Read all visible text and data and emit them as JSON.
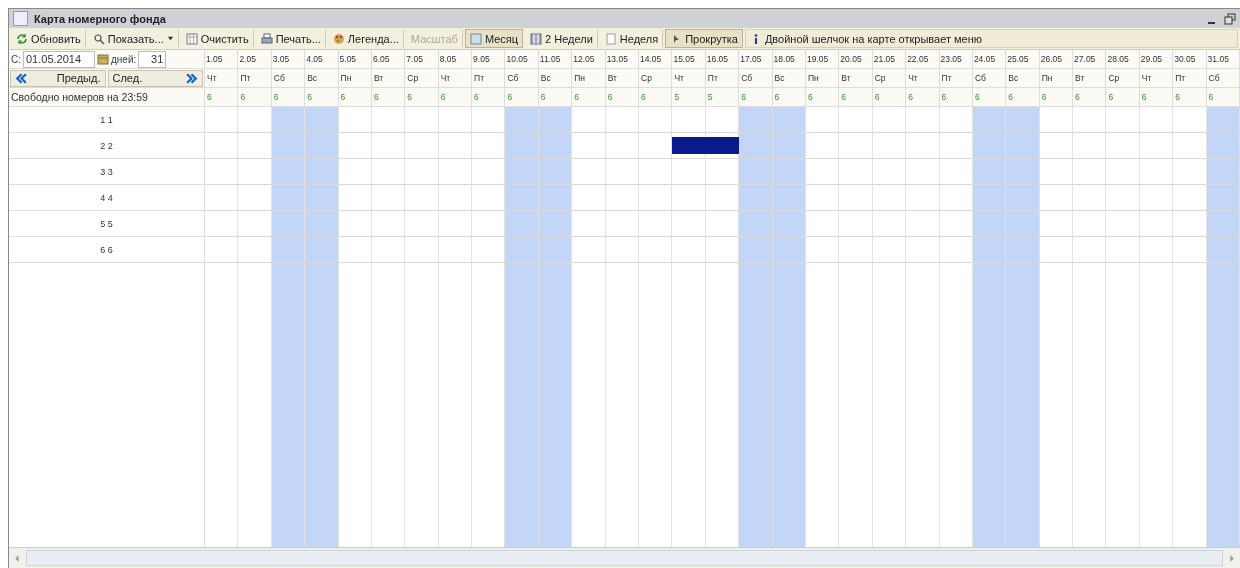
{
  "window": {
    "title": "Карта номерного фонда"
  },
  "toolbar": [
    {
      "kind": "refresh",
      "label": "Обновить",
      "pressed": false,
      "disabled": false
    },
    {
      "kind": "dropdown",
      "label": "Показать...",
      "pressed": false,
      "disabled": false
    },
    {
      "kind": "clear",
      "label": "Очистить",
      "pressed": false,
      "disabled": false
    },
    {
      "kind": "print",
      "label": "Печать...",
      "pressed": false,
      "disabled": false
    },
    {
      "kind": "legend",
      "label": "Легенда...",
      "pressed": false,
      "disabled": false
    },
    {
      "kind": "plain",
      "label": "Масштаб",
      "pressed": false,
      "disabled": true
    },
    {
      "kind": "month",
      "label": "Месяц",
      "pressed": true,
      "disabled": false
    },
    {
      "kind": "twoweeks",
      "label": "2 Недели",
      "pressed": false,
      "disabled": false
    },
    {
      "kind": "week",
      "label": "Неделя",
      "pressed": false,
      "disabled": false
    },
    {
      "kind": "scroll",
      "label": "Прокрутка",
      "pressed": true,
      "disabled": false
    },
    {
      "kind": "info",
      "label": "Двойной шелчок на карте открывает меню",
      "pressed": false,
      "disabled": false
    }
  ],
  "period": {
    "from_label": "С:",
    "from_value": "01.05.2014",
    "days_label": "дней:",
    "days_value": "31"
  },
  "nav": {
    "prev": "Предыд.",
    "next": "След."
  },
  "free_label": "Свободно номеров на 23:59",
  "days": [
    {
      "date": "1.05",
      "weekday": "Чт",
      "free": "6",
      "weekend": false
    },
    {
      "date": "2.05",
      "weekday": "Пт",
      "free": "6",
      "weekend": false
    },
    {
      "date": "3.05",
      "weekday": "Сб",
      "free": "6",
      "weekend": true
    },
    {
      "date": "4.05",
      "weekday": "Вс",
      "free": "6",
      "weekend": true
    },
    {
      "date": "5.05",
      "weekday": "Пн",
      "free": "6",
      "weekend": false
    },
    {
      "date": "6.05",
      "weekday": "Вт",
      "free": "6",
      "weekend": false
    },
    {
      "date": "7.05",
      "weekday": "Ср",
      "free": "6",
      "weekend": false
    },
    {
      "date": "8.05",
      "weekday": "Чт",
      "free": "6",
      "weekend": false
    },
    {
      "date": "9.05",
      "weekday": "Пт",
      "free": "6",
      "weekend": false
    },
    {
      "date": "10.05",
      "weekday": "Сб",
      "free": "6",
      "weekend": true
    },
    {
      "date": "11.05",
      "weekday": "Вс",
      "free": "6",
      "weekend": true
    },
    {
      "date": "12.05",
      "weekday": "Пн",
      "free": "6",
      "weekend": false
    },
    {
      "date": "13.05",
      "weekday": "Вт",
      "free": "6",
      "weekend": false
    },
    {
      "date": "14.05",
      "weekday": "Ср",
      "free": "6",
      "weekend": false
    },
    {
      "date": "15.05",
      "weekday": "Чт",
      "free": "5",
      "weekend": false
    },
    {
      "date": "16.05",
      "weekday": "Пт",
      "free": "5",
      "weekend": false
    },
    {
      "date": "17.05",
      "weekday": "Сб",
      "free": "6",
      "weekend": true
    },
    {
      "date": "18.05",
      "weekday": "Вс",
      "free": "6",
      "weekend": true
    },
    {
      "date": "19.05",
      "weekday": "Пн",
      "free": "6",
      "weekend": false
    },
    {
      "date": "20.05",
      "weekday": "Вт",
      "free": "6",
      "weekend": false
    },
    {
      "date": "21.05",
      "weekday": "Ср",
      "free": "6",
      "weekend": false
    },
    {
      "date": "22.05",
      "weekday": "Чт",
      "free": "6",
      "weekend": false
    },
    {
      "date": "23.05",
      "weekday": "Пт",
      "free": "6",
      "weekend": false
    },
    {
      "date": "24.05",
      "weekday": "Сб",
      "free": "6",
      "weekend": true
    },
    {
      "date": "25.05",
      "weekday": "Вс",
      "free": "6",
      "weekend": true
    },
    {
      "date": "26.05",
      "weekday": "Пн",
      "free": "6",
      "weekend": false
    },
    {
      "date": "27.05",
      "weekday": "Вт",
      "free": "6",
      "weekend": false
    },
    {
      "date": "28.05",
      "weekday": "Ср",
      "free": "6",
      "weekend": false
    },
    {
      "date": "29.05",
      "weekday": "Чт",
      "free": "6",
      "weekend": false
    },
    {
      "date": "30.05",
      "weekday": "Пт",
      "free": "6",
      "weekend": false
    },
    {
      "date": "31.05",
      "weekday": "Сб",
      "free": "6",
      "weekend": true
    }
  ],
  "rooms": [
    {
      "name": "1 1",
      "occupied": [
        false,
        false,
        false,
        false,
        false,
        false,
        false,
        false,
        false,
        false,
        false,
        false,
        false,
        false,
        false,
        false,
        false,
        false,
        false,
        false,
        false,
        false,
        false,
        false,
        false,
        false,
        false,
        false,
        false,
        false,
        false
      ]
    },
    {
      "name": "2 2",
      "occupied": [
        false,
        false,
        false,
        false,
        false,
        false,
        false,
        false,
        false,
        false,
        false,
        false,
        false,
        false,
        true,
        true,
        false,
        false,
        false,
        false,
        false,
        false,
        false,
        false,
        false,
        false,
        false,
        false,
        false,
        false,
        false
      ]
    },
    {
      "name": "3 3",
      "occupied": [
        false,
        false,
        false,
        false,
        false,
        false,
        false,
        false,
        false,
        false,
        false,
        false,
        false,
        false,
        false,
        false,
        false,
        false,
        false,
        false,
        false,
        false,
        false,
        false,
        false,
        false,
        false,
        false,
        false,
        false,
        false
      ]
    },
    {
      "name": "4 4",
      "occupied": [
        false,
        false,
        false,
        false,
        false,
        false,
        false,
        false,
        false,
        false,
        false,
        false,
        false,
        false,
        false,
        false,
        false,
        false,
        false,
        false,
        false,
        false,
        false,
        false,
        false,
        false,
        false,
        false,
        false,
        false,
        false
      ]
    },
    {
      "name": "5 5",
      "occupied": [
        false,
        false,
        false,
        false,
        false,
        false,
        false,
        false,
        false,
        false,
        false,
        false,
        false,
        false,
        false,
        false,
        false,
        false,
        false,
        false,
        false,
        false,
        false,
        false,
        false,
        false,
        false,
        false,
        false,
        false,
        false
      ]
    },
    {
      "name": "6 6",
      "occupied": [
        false,
        false,
        false,
        false,
        false,
        false,
        false,
        false,
        false,
        false,
        false,
        false,
        false,
        false,
        false,
        false,
        false,
        false,
        false,
        false,
        false,
        false,
        false,
        false,
        false,
        false,
        false,
        false,
        false,
        false,
        false
      ]
    }
  ]
}
